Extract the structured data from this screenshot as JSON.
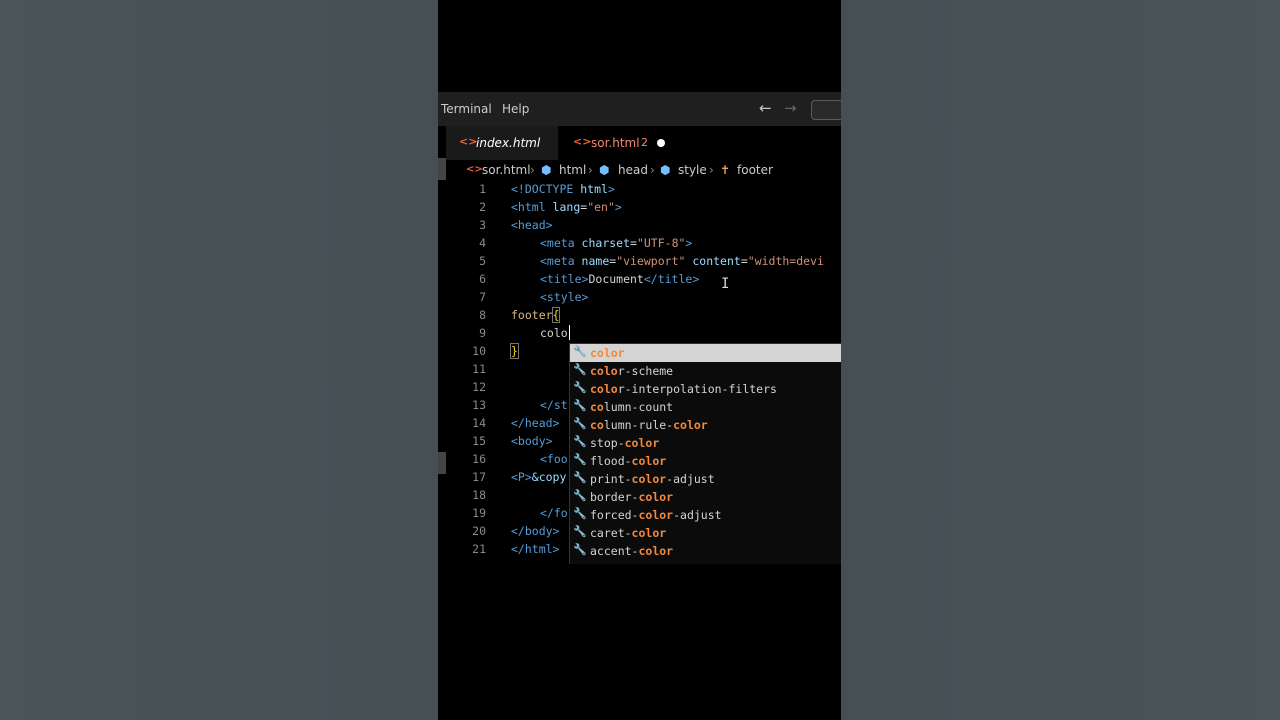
{
  "menubar": {
    "terminal": "Terminal",
    "help": "Help",
    "back_icon": "arrow-left-icon",
    "forward_icon": "arrow-right-icon"
  },
  "tabs": [
    {
      "label": "index.html",
      "icon": "code-icon"
    },
    {
      "label": "sor.html",
      "icon": "code-icon",
      "problems": "2"
    }
  ],
  "breadcrumb": [
    "sor.html",
    "html",
    "head",
    "style",
    "footer"
  ],
  "editor": {
    "line_numbers": [
      "1",
      "2",
      "3",
      "4",
      "5",
      "6",
      "7",
      "8",
      "9",
      "10",
      "11",
      "12",
      "13",
      "14",
      "15",
      "16",
      "17",
      "18",
      "19",
      "20",
      "21"
    ]
  },
  "code": {
    "l1": {
      "a": "<!DOCTYPE",
      "b": " html",
      "c": ">"
    },
    "l2": {
      "a": "<html",
      "b": " lang",
      "c": "=",
      "d": "\"en\"",
      "e": ">"
    },
    "l3": {
      "a": "<head>"
    },
    "l4": {
      "a": "<meta",
      "b": " charset",
      "c": "=",
      "d": "\"UTF-8\"",
      "e": ">"
    },
    "l5": {
      "a": "<meta",
      "b": " name",
      "c": "=",
      "d": "\"viewport\"",
      "e": " content",
      "f": "=",
      "g": "\"width=devi"
    },
    "l6": {
      "a": "<title>",
      "b": "Document",
      "c": "</title>"
    },
    "l7": {
      "a": "<style>"
    },
    "l8": {
      "a": "footer",
      "b": "{"
    },
    "l9": {
      "a": "colo"
    },
    "l10": {
      "a": "}"
    },
    "l13": {
      "a": "</st"
    },
    "l14": {
      "a": "</head>"
    },
    "l15": {
      "a": "<body>"
    },
    "l16": {
      "a": "<foo"
    },
    "l17": {
      "a": "<P>",
      "b": "&copy"
    },
    "l19": {
      "a": "</fo"
    },
    "l20": {
      "a": "</body>"
    },
    "l21": {
      "a": "</html>"
    }
  },
  "suggestions": [
    {
      "match": "colo",
      "rest": "r",
      "pre": ""
    },
    {
      "match": "colo",
      "rest": "r-scheme",
      "pre": ""
    },
    {
      "match": "colo",
      "rest": "r-interpolation-filters",
      "pre": ""
    },
    {
      "match": "co",
      "rest": "lumn-count",
      "pre": ""
    },
    {
      "pre": "",
      "match": "co",
      "rest": "lumn-rule-",
      "post_match": "color"
    },
    {
      "pre": "stop-",
      "match": "color",
      "rest": ""
    },
    {
      "pre": "flood-",
      "match": "color",
      "rest": ""
    },
    {
      "pre": "print-",
      "match": "color",
      "rest": "-adjust"
    },
    {
      "pre": "border-",
      "match": "color",
      "rest": ""
    },
    {
      "pre": "forced-",
      "match": "color",
      "rest": "-adjust"
    },
    {
      "pre": "caret-",
      "match": "color",
      "rest": ""
    },
    {
      "pre": "accent-",
      "match": "color",
      "rest": ""
    }
  ],
  "suggestion_icon": "wrench-icon"
}
